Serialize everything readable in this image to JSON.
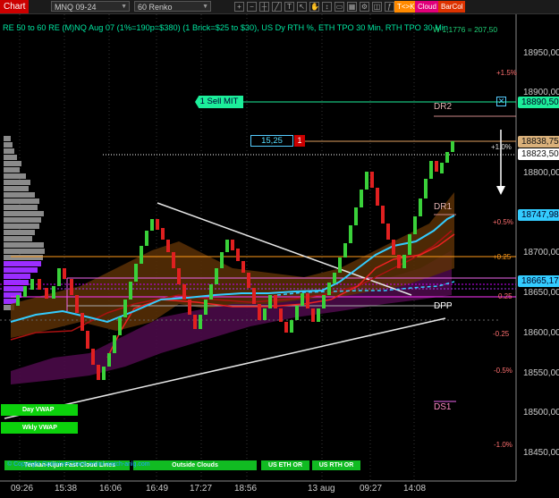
{
  "toolbar": {
    "chart_label": "Chart",
    "instrument": "MNQ 09-24",
    "bar_type": "60 Renko",
    "btn_tohk": "T<>K",
    "btn_cloud": "Cloud",
    "btn_barcol": "BarCol",
    "colors": {
      "chart": "#cc0000",
      "tohk": "#ff8a00",
      "cloud": "#e0007a",
      "barcol": "#dd3300"
    }
  },
  "header": {
    "title": "RE 50 to 60 RE (M)NQ Aug 07 (1%=190p=$380) (1 Brick=$25 to $30), US Dy RTH %, ETH TPO 30 Min, RTH TPO 30 Min",
    "subtitle": "W 1,1776 = 207,50"
  },
  "price_axis": {
    "labels": [
      "18950,00",
      "18900,00",
      "18800,00",
      "18700,00",
      "18650,00",
      "18600,00",
      "18550,00",
      "18500,00",
      "18450,00"
    ],
    "markers": {
      "resistance": "18890,50",
      "position": "18838,75",
      "last": "18823,50",
      "upper": "18747,98",
      "lower": "18665,17"
    }
  },
  "percent_levels": [
    "+1.5%",
    "+1.0%",
    "+0.5%",
    "+0.25",
    "0.25",
    "-0.25",
    "-0.5%",
    "-1.0%"
  ],
  "levels": {
    "dr2": "DR2",
    "dr1": "DR1",
    "dpp": "DPP",
    "ds1": "DS1"
  },
  "order": {
    "label": "1 Sell MIT",
    "close": "✕"
  },
  "position": {
    "pnl": "15,25",
    "qty": "1"
  },
  "time_axis": [
    "09:26",
    "15:38",
    "16:06",
    "16:49",
    "17:27",
    "18:56",
    "13 aug",
    "09:27",
    "14:08"
  ],
  "legend_buttons": {
    "day_vwap": "Day VWAP",
    "wkly_vwap": "Wkly VWAP",
    "cloud_lines": "Tenkan-Kijun Fast Cloud Lines",
    "outside_clouds": "Outside Clouds",
    "us_eth_or": "US ETH OR",
    "us_rth_or": "US RTH OR"
  },
  "copyright": "© Copyright OptimizerCharts.emini-watch-anlg.com"
}
